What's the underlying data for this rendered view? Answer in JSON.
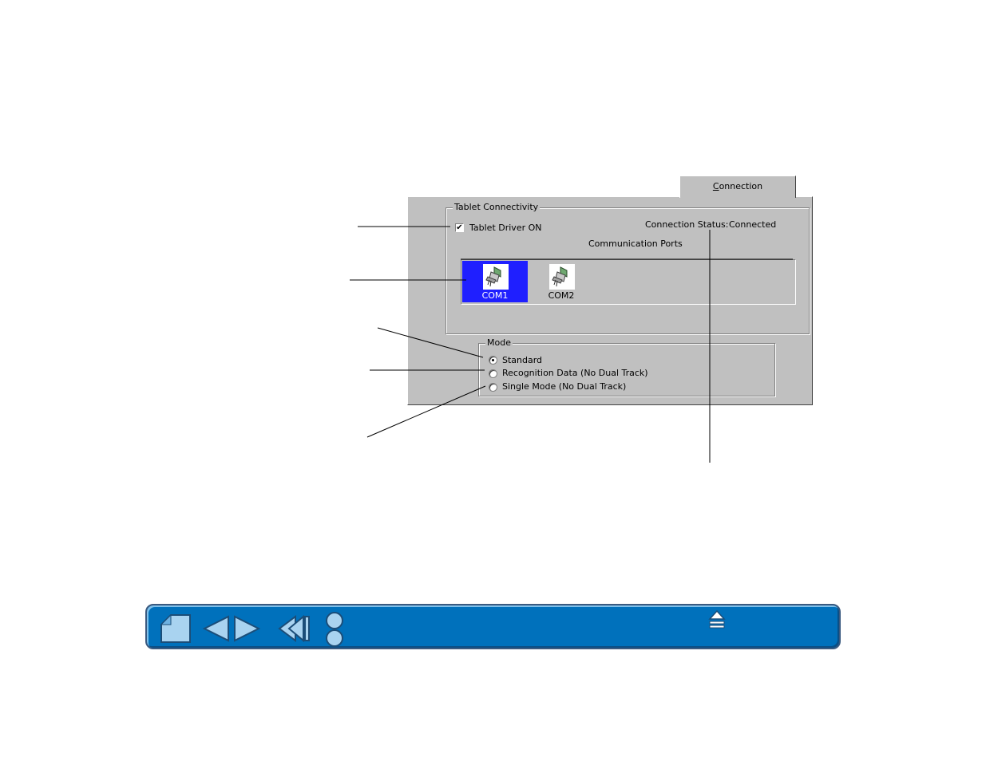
{
  "tab": {
    "label_prefix": "",
    "label_underlined": "C",
    "label_rest": "onnection"
  },
  "connectivity": {
    "group_title": "Tablet Connectivity",
    "driver_checkbox": {
      "label": "Tablet Driver ON",
      "checked": true,
      "mark": "✔"
    },
    "status_label": "Connection Status:",
    "status_value": "Connected",
    "ports_title": "Communication Ports",
    "ports": [
      {
        "label": "COM1",
        "selected": true
      },
      {
        "label": "COM2",
        "selected": false
      }
    ]
  },
  "mode": {
    "group_title": "Mode",
    "options": [
      {
        "label": "Standard",
        "checked": true
      },
      {
        "label": "Recognition Data (No Dual Track)",
        "checked": false
      },
      {
        "label": "Single Mode (No Dual Track)",
        "checked": false
      }
    ]
  },
  "navbar": {
    "buttons": [
      "home-icon",
      "previous-page-icon",
      "next-page-icon",
      "back-icon",
      "toggle-icon",
      "eject-icon"
    ]
  },
  "colors": {
    "panel": "#c0c0c0",
    "selected_port": "#1f1fff",
    "navbar": "#0071bc"
  }
}
